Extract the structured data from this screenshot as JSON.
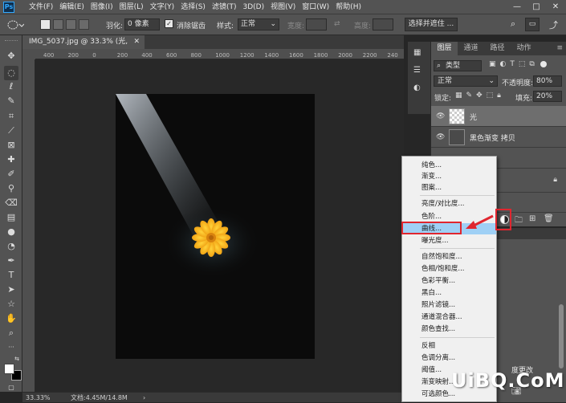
{
  "app": {
    "logo": "Ps"
  },
  "menubar": {
    "items": [
      "文件(F)",
      "编辑(E)",
      "图像(I)",
      "图层(L)",
      "文字(Y)",
      "选择(S)",
      "滤镜(T)",
      "3D(D)",
      "视图(V)",
      "窗口(W)",
      "帮助(H)"
    ],
    "minimize": "—",
    "maximize": "□",
    "close": "✕"
  },
  "options": {
    "feather_label": "羽化:",
    "feather_value": "0 像素",
    "antialias_label": "消除锯齿",
    "antialias_checked": true,
    "style_label": "样式:",
    "style_value": "正常",
    "width_label": "宽度:",
    "height_label": "高度:",
    "select_mask_button": "选择并遮住 ..."
  },
  "document": {
    "tab_title": "IMG_5037.jpg @ 33.3% (光, RGB/8) *",
    "zoom": "33.33%",
    "doc_size": "文档:4.45M/14.8M"
  },
  "ruler": {
    "h_ticks": [
      "400",
      "200",
      "0",
      "200",
      "400",
      "600",
      "800",
      "1000",
      "1200",
      "1400",
      "1600",
      "1800",
      "2000",
      "2200",
      "240"
    ]
  },
  "tools": [
    "move-tool",
    "marquee-tool",
    "lasso-tool",
    "quick-select-tool",
    "crop-tool",
    "eyedropper-tool",
    "healing-tool",
    "brush-tool",
    "clone-stamp-tool",
    "history-brush-tool",
    "eraser-tool",
    "gradient-tool",
    "blur-tool",
    "dodge-tool",
    "pen-tool",
    "type-tool",
    "path-select-tool",
    "shape-tool",
    "hand-tool",
    "zoom-tool"
  ],
  "colors": {
    "foreground": "#ffffff",
    "background": "#000000",
    "highlight": "#9fd0f5",
    "annotation": "#e0262f"
  },
  "layers_panel": {
    "tabs": [
      "图层",
      "通道",
      "路径",
      "动作"
    ],
    "active_tab": 0,
    "filter_label": "类型",
    "blend_mode": "正常",
    "opacity_label": "不透明度:",
    "opacity_value": "80%",
    "lock_label": "锁定:",
    "fill_label": "填充:",
    "fill_value": "20%",
    "layers": [
      {
        "name": "光",
        "visible": true,
        "selected": true
      },
      {
        "name": "黑色渐变 拷贝",
        "visible": true,
        "selected": false
      }
    ]
  },
  "adjustment_menu": {
    "groups": [
      [
        "纯色...",
        "渐变...",
        "图案..."
      ],
      [
        "亮度/对比度...",
        "色阶...",
        "曲线...",
        "曝光度..."
      ],
      [
        "自然饱和度...",
        "色相/饱和度...",
        "色彩平衡...",
        "黑白...",
        "照片滤镜...",
        "通道混合器...",
        "颜色查找..."
      ],
      [
        "反相",
        "色调分离...",
        "阈值...",
        "渐变映射...",
        "可选颜色..."
      ]
    ],
    "highlighted": "曲线..."
  },
  "history_panel": {
    "partial_text": "度更改"
  },
  "watermark": "UiBQ.CoM"
}
